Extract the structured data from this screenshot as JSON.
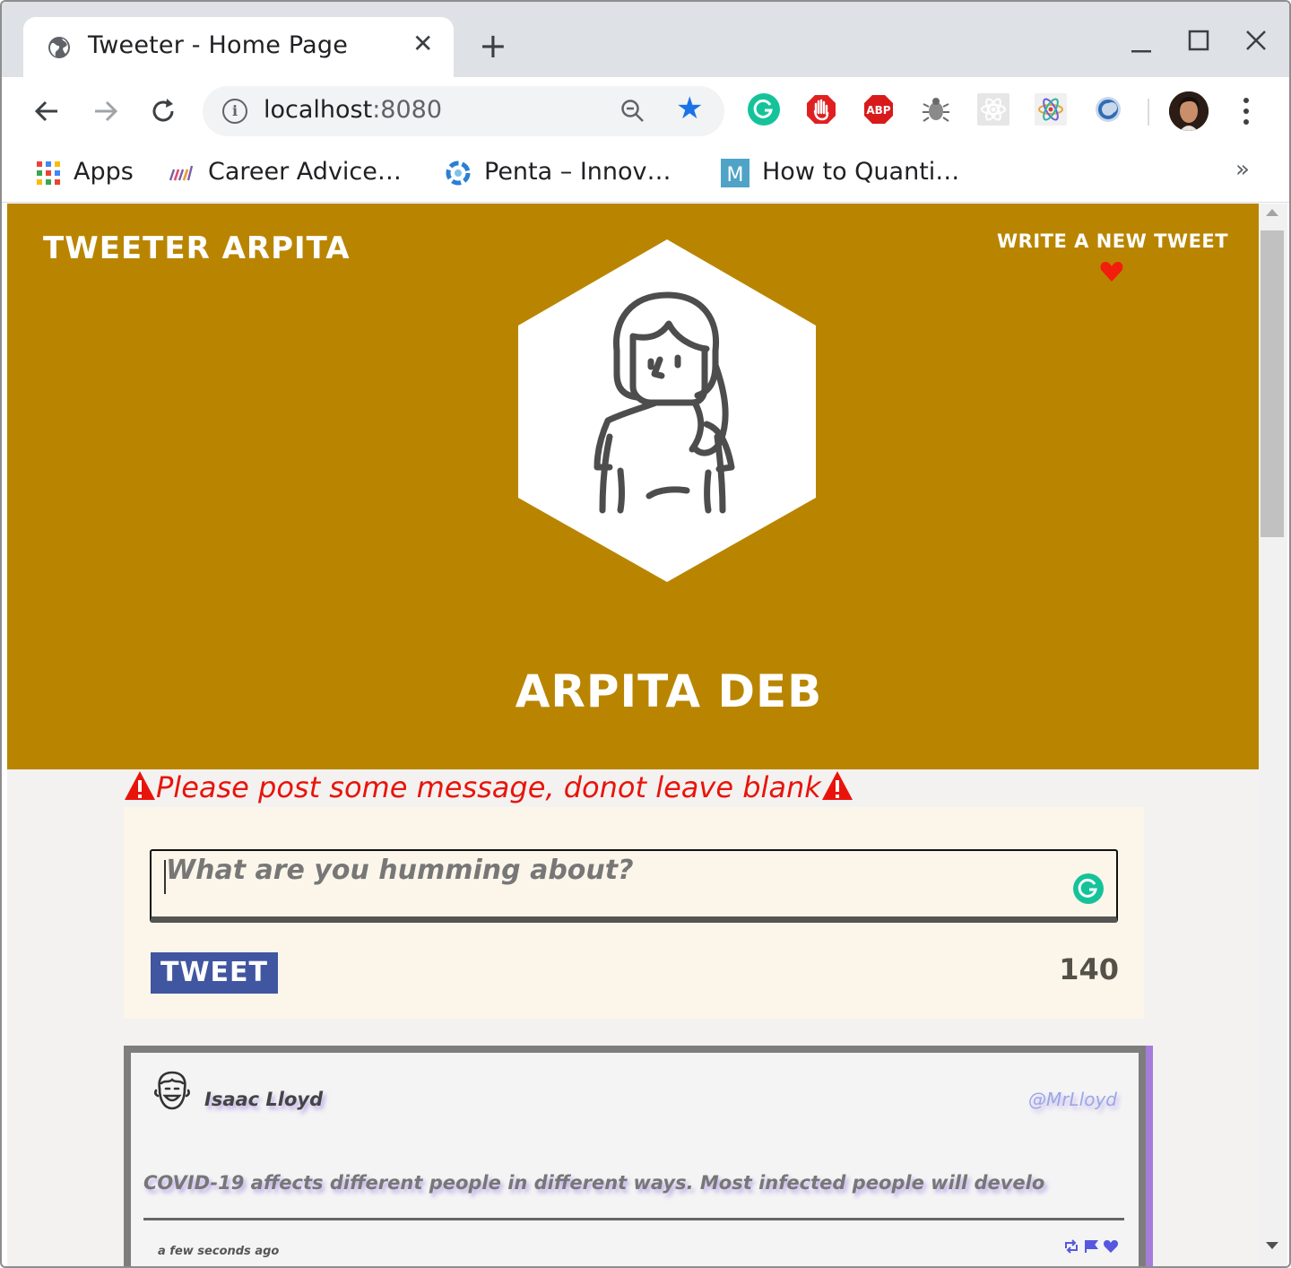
{
  "browser": {
    "tab": {
      "title": "Tweeter - Home Page",
      "close": "✕"
    },
    "new_tab": "+",
    "window_controls": {
      "minimize": "—",
      "maximize": "☐",
      "close": "✕"
    },
    "omnibox": {
      "host": "localhost",
      "port": ":8080"
    },
    "bookmarks": [
      {
        "label": "Apps"
      },
      {
        "label": "Career Advice…"
      },
      {
        "label": "Penta – Innov…"
      },
      {
        "label": "How to Quanti…"
      }
    ],
    "bookmarks_more": "»",
    "extensions": [
      "grammarly-icon",
      "adblock-hand-icon",
      "abp-icon",
      "bug-icon",
      "react-devtools-icon",
      "atom-icon",
      "ring-icon"
    ],
    "ext_labels": {
      "abp": "ABP",
      "m": "M"
    }
  },
  "page": {
    "brand": "Tweeter Arpita",
    "write_new": "Write a new tweet",
    "profile_name": "Arpita Deb",
    "error": "Please post some message, donot leave blank",
    "compose": {
      "placeholder": "What are you humming about?",
      "button_label": "TWEET",
      "counter": "140"
    },
    "tweets": [
      {
        "name": "Isaac Lloyd",
        "handle": "@MrLloyd",
        "text": "COVID-19 affects different people in different ways. Most infected people will develo",
        "time": "a few seconds ago",
        "actions": [
          "retweet-icon",
          "flag-icon",
          "heart-icon"
        ]
      }
    ]
  },
  "colors": {
    "header_bg": "#b98500",
    "error": "#e8140c",
    "compose_bg": "#fcf6ea",
    "tweet_button": "#4056a1",
    "page_bg": "#f4f2f0",
    "accent_shadow": "#a47cdc"
  }
}
